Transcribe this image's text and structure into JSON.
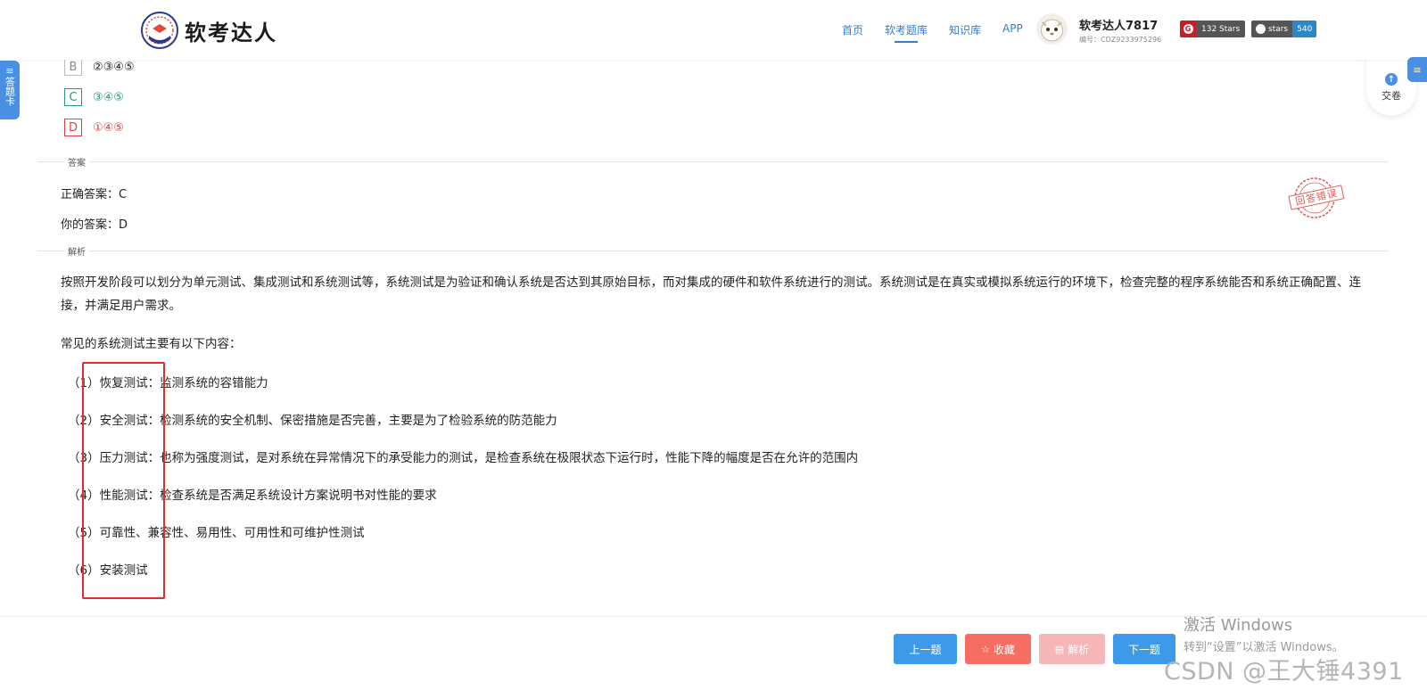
{
  "header": {
    "logo_text": "软考达人",
    "nav": [
      "首页",
      "软考题库",
      "知识库",
      "APP"
    ],
    "active_nav": 1,
    "username": "软考达人7817",
    "user_id": "编号：CDZ9233975296",
    "gitee_stars": "132 Stars",
    "github_label": "stars",
    "github_count": "540"
  },
  "sidebar": {
    "answer_card_label": "答题卡",
    "submit_label": "交卷"
  },
  "options": [
    {
      "letter": "B",
      "value": "②③④⑤"
    },
    {
      "letter": "C",
      "value": "③④⑤"
    },
    {
      "letter": "D",
      "value": "①④⑤"
    }
  ],
  "answer": {
    "section_label": "答案",
    "correct": "正确答案：C",
    "yours": "你的答案：D",
    "stamp_text": "回答错误"
  },
  "analysis": {
    "section_label": "解析",
    "paragraph1": "按照开发阶段可以划分为单元测试、集成测试和系统测试等，系统测试是为验证和确认系统是否达到其原始目标，而对集成的硬件和软件系统进行的测试。系统测试是在真实或模拟系统运行的环境下，检查完整的程序系统能否和系统正确配置、连接，并满足用户需求。",
    "paragraph2": "常见的系统测试主要有以下内容：",
    "items": [
      "（1）恢复测试：监测系统的容错能力",
      "（2）安全测试：检测系统的安全机制、保密措施是否完善，主要是为了检验系统的防范能力",
      "（3）压力测试：也称为强度测试，是对系统在异常情况下的承受能力的测试，是检查系统在极限状态下运行时，性能下降的幅度是否在允许的范围内",
      "（4）性能测试：检查系统是否满足系统设计方案说明书对性能的要求",
      "（5）可靠性、兼容性、易用性、可用性和可维护性测试",
      "（6）安装测试"
    ]
  },
  "footer": {
    "prev": "上一题",
    "favorite": "收藏",
    "analysis": "解析",
    "next": "下一题"
  },
  "watermarks": {
    "windows_line1": "激活 Windows",
    "windows_line2": "转到“设置”以激活 Windows。",
    "csdn": "CSDN @王大锤4391"
  }
}
